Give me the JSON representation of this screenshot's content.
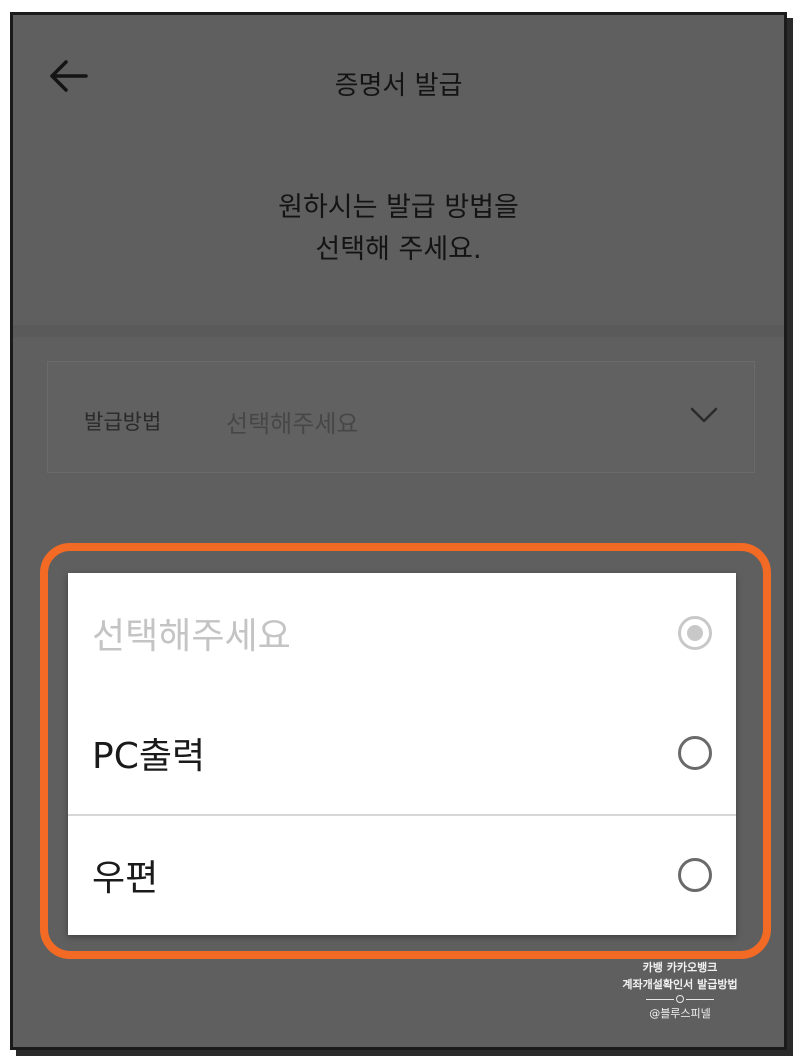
{
  "header": {
    "title": "증명서 발급",
    "back_icon": "arrow-left-icon"
  },
  "instruction": {
    "line1": "원하시는 발급 방법을",
    "line2": "선택해 주세요."
  },
  "field": {
    "label": "발급방법",
    "value": "선택해주세요",
    "icon": "chevron-down-icon"
  },
  "dialog": {
    "options": [
      {
        "label": "선택해주세요",
        "selected": true,
        "disabled": true
      },
      {
        "label": "PC출력",
        "selected": false,
        "disabled": false
      },
      {
        "label": "우편",
        "selected": false,
        "disabled": false
      }
    ]
  },
  "watermark": {
    "line1": "카뱅 카카오뱅크",
    "line2": "계좌개설확인서 발급방법",
    "handle": "@블루스피넬"
  },
  "colors": {
    "highlight": "#f26a24",
    "overlay": "#5f5f5f"
  }
}
